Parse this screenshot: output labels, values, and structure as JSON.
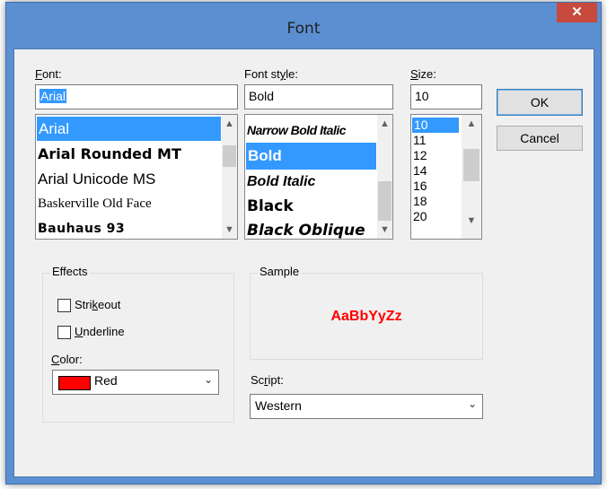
{
  "dialog": {
    "title": "Font",
    "close_glyph": "✕"
  },
  "font": {
    "label_pre": "",
    "label_u": "F",
    "label_post": "ont:",
    "value": "Arial",
    "items": [
      "Arial",
      "Arial Rounded MT",
      "Arial Unicode MS",
      "Baskerville Old Face",
      "Bauhaus 93"
    ],
    "selected": "Arial"
  },
  "style": {
    "label_pre": "Font st",
    "label_u": "y",
    "label_post": "le:",
    "value": "Bold",
    "items": [
      "Narrow Bold Italic",
      "Bold",
      "Bold Italic",
      "Black",
      "Black Oblique"
    ],
    "selected": "Bold"
  },
  "size": {
    "label_pre": "",
    "label_u": "S",
    "label_post": "ize:",
    "value": "10",
    "items": [
      "10",
      "11",
      "12",
      "14",
      "16",
      "18",
      "20"
    ],
    "selected": "10"
  },
  "buttons": {
    "ok": "OK",
    "cancel": "Cancel"
  },
  "effects": {
    "title": "Effects",
    "strikeout_pre": "Stri",
    "strikeout_u": "k",
    "strikeout_post": "eout",
    "strikeout_checked": false,
    "underline_pre": "",
    "underline_u": "U",
    "underline_post": "nderline",
    "underline_checked": false,
    "color_label_pre": "",
    "color_label_u": "C",
    "color_label_post": "olor:",
    "color_value": "Red",
    "color_swatch": "#ff0000"
  },
  "sample": {
    "title": "Sample",
    "text": "AaBbYyZz",
    "color": "#ff0000"
  },
  "script": {
    "label_pre": "Sc",
    "label_u": "r",
    "label_post": "ipt:",
    "value": "Western"
  },
  "icons": {
    "scroll_up": "▲",
    "scroll_down": "▼",
    "dropdown": "⌄"
  }
}
